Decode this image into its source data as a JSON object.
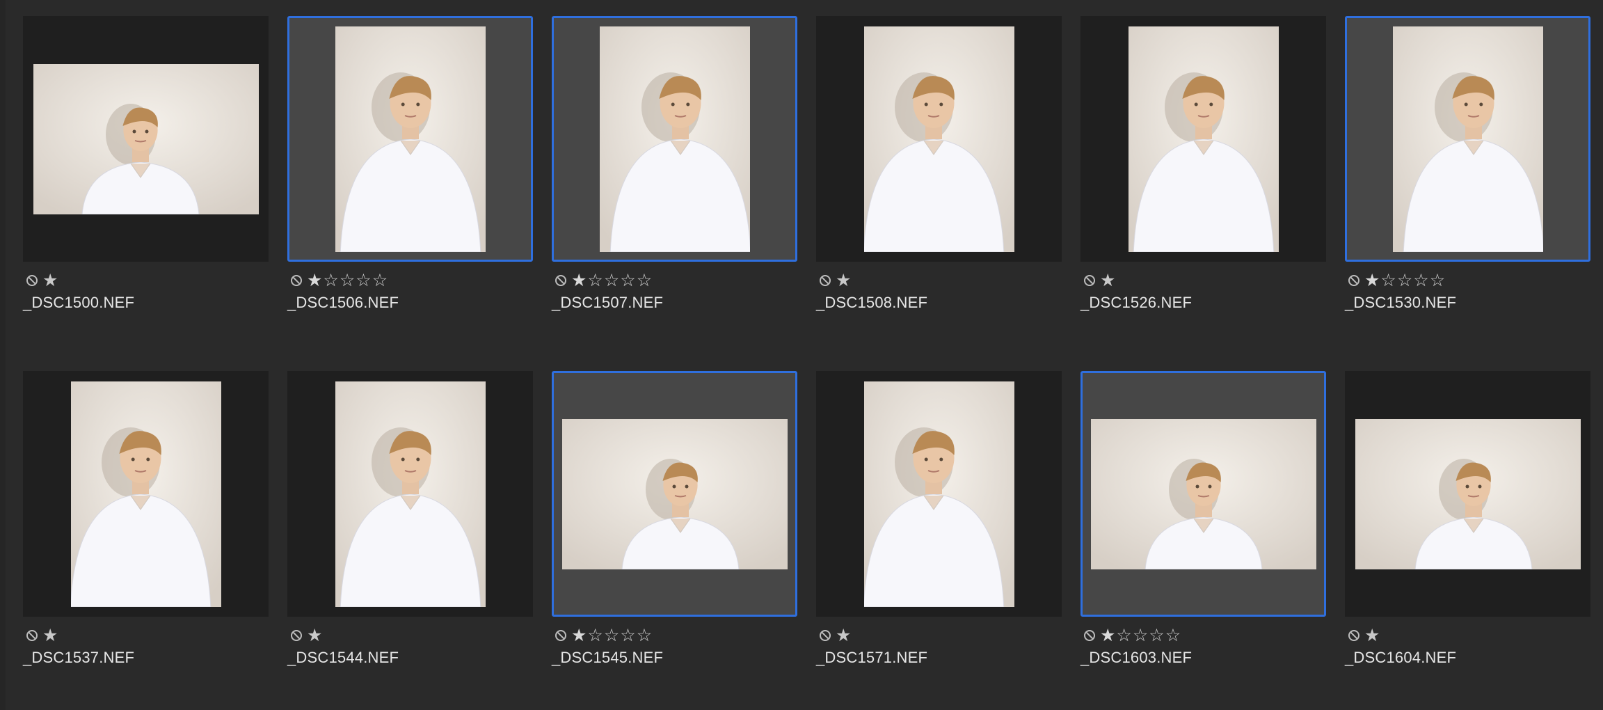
{
  "colors": {
    "background": "#2a2a2a",
    "selection_border": "#2f6fde",
    "selected_thumb_bg": "#474747",
    "thumb_bg": "#1f1f1f"
  },
  "icons": {
    "reject": "reject-flag-icon",
    "star_filled": "★",
    "star_empty": "☆"
  },
  "photos": [
    {
      "filename": "_DSC1500.NEF",
      "selected": false,
      "orientation": "landscape",
      "rating": 1,
      "stars_shown": 1
    },
    {
      "filename": "_DSC1506.NEF",
      "selected": true,
      "orientation": "portrait",
      "rating": 1,
      "stars_shown": 5
    },
    {
      "filename": "_DSC1507.NEF",
      "selected": true,
      "orientation": "portrait",
      "rating": 1,
      "stars_shown": 5
    },
    {
      "filename": "_DSC1508.NEF",
      "selected": false,
      "orientation": "portrait",
      "rating": 1,
      "stars_shown": 1
    },
    {
      "filename": "_DSC1526.NEF",
      "selected": false,
      "orientation": "portrait",
      "rating": 1,
      "stars_shown": 1
    },
    {
      "filename": "_DSC1530.NEF",
      "selected": true,
      "orientation": "portrait",
      "rating": 1,
      "stars_shown": 5
    },
    {
      "filename": "_DSC1537.NEF",
      "selected": false,
      "orientation": "portrait",
      "rating": 1,
      "stars_shown": 1
    },
    {
      "filename": "_DSC1544.NEF",
      "selected": false,
      "orientation": "portrait",
      "rating": 1,
      "stars_shown": 1
    },
    {
      "filename": "_DSC1545.NEF",
      "selected": true,
      "orientation": "landscape",
      "rating": 1,
      "stars_shown": 5
    },
    {
      "filename": "_DSC1571.NEF",
      "selected": false,
      "orientation": "portrait",
      "rating": 1,
      "stars_shown": 1
    },
    {
      "filename": "_DSC1603.NEF",
      "selected": true,
      "orientation": "landscape",
      "rating": 1,
      "stars_shown": 5
    },
    {
      "filename": "_DSC1604.NEF",
      "selected": false,
      "orientation": "landscape",
      "rating": 1,
      "stars_shown": 1
    }
  ]
}
